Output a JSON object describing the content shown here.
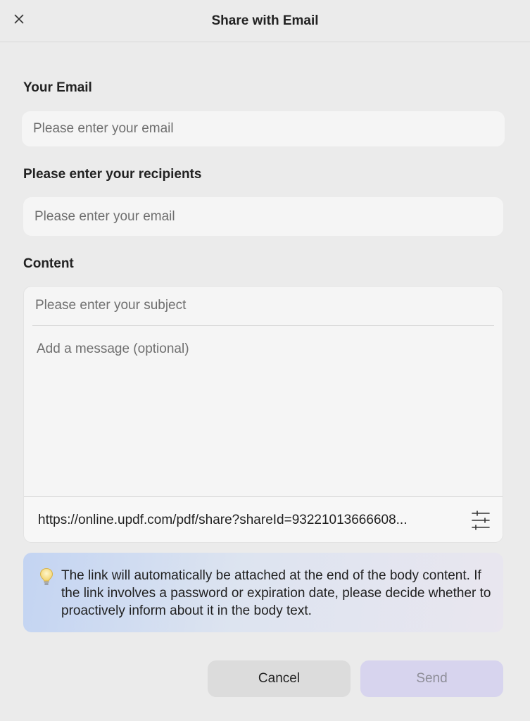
{
  "header": {
    "title": "Share with Email",
    "close_icon": "close-icon"
  },
  "your_email": {
    "label": "Your Email",
    "value": "",
    "placeholder": "Please enter your email"
  },
  "recipients": {
    "label": "Please enter your recipients",
    "value": "",
    "placeholder": "Please enter your email"
  },
  "content": {
    "label": "Content",
    "subject_placeholder": "Please enter your subject",
    "message_placeholder": "Add a message (optional)",
    "link": "https://online.updf.com/pdf/share?shareId=93221013666608...",
    "settings_icon": "sliders-icon"
  },
  "notice": {
    "icon": "lightbulb-icon",
    "text": "The link will automatically be attached at the end of the body content. If the link involves a password or expiration date, please decide whether to proactively inform about it in the body text."
  },
  "actions": {
    "cancel_label": "Cancel",
    "send_label": "Send"
  },
  "colors": {
    "background": "#ebebeb",
    "input_background": "#f5f5f5",
    "send_button": "#d7d4ee",
    "cancel_button": "#dcdcdc",
    "notice_gradient_start": "#c3d4f2",
    "notice_gradient_end": "#e9e6ef"
  }
}
